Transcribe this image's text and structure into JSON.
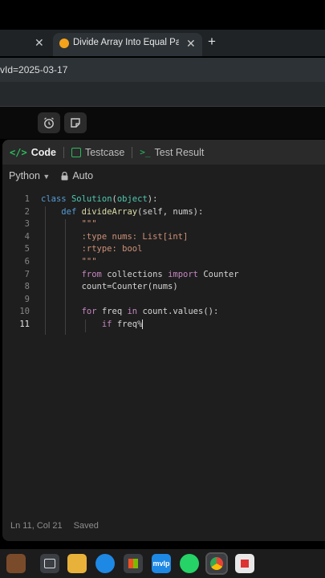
{
  "browser": {
    "inactive_tab_close": "✕",
    "active_tab_title": "Divide Array Into Equal Pairs - L",
    "active_tab_close": "✕",
    "new_tab": "+",
    "address": "vId=2025-03-17"
  },
  "panel": {
    "tabs": [
      {
        "label": "Code"
      },
      {
        "label": "Testcase"
      },
      {
        "label": "Test Result"
      }
    ],
    "language": "Python",
    "auto_label": "Auto"
  },
  "editor": {
    "line_numbers": [
      "1",
      "2",
      "3",
      "4",
      "5",
      "6",
      "7",
      "8",
      "9",
      "10",
      "11"
    ],
    "active_line": "11"
  },
  "status": {
    "position": "Ln 11, Col 21",
    "saved": "Saved"
  },
  "taskbar": {
    "mvlp_label": "mvlp",
    "colors": {
      "accent_green": "#2cbb5d",
      "edge_blue": "#1e88e5"
    }
  }
}
